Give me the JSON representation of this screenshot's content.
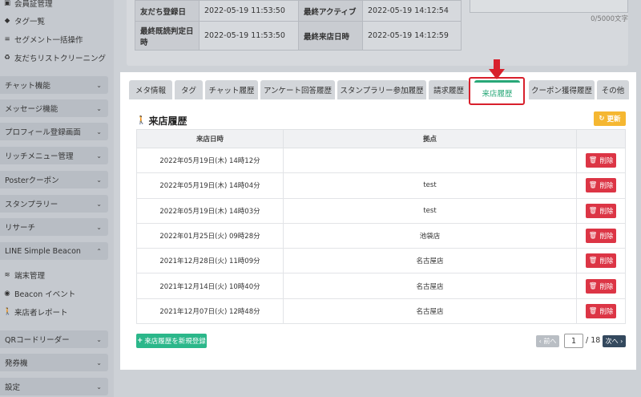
{
  "sidebar": {
    "top_items": [
      {
        "label": "会員証管理",
        "icon": "id-card-icon"
      },
      {
        "label": "タグ一覧",
        "icon": "tag-icon"
      },
      {
        "label": "セグメント一括操作",
        "icon": "database-icon"
      },
      {
        "label": "友だちリストクリーニング",
        "icon": "recycle-icon"
      }
    ],
    "sections": [
      {
        "label": "チャット機能"
      },
      {
        "label": "メッセージ機能"
      },
      {
        "label": "プロフィール登録画面"
      },
      {
        "label": "リッチメニュー管理"
      },
      {
        "label": "Posterクーポン"
      },
      {
        "label": "スタンプラリー"
      },
      {
        "label": "リサーチ"
      },
      {
        "label": "LINE Simple Beacon"
      }
    ],
    "beacon_items": [
      {
        "label": "端末管理",
        "icon": "wifi-icon"
      },
      {
        "label": "Beacon イベント",
        "icon": "broadcast-icon"
      },
      {
        "label": "来店者レポート",
        "icon": "walking-person-icon"
      }
    ],
    "bottom_sections": [
      {
        "label": "QRコードリーダー"
      },
      {
        "label": "発券機"
      },
      {
        "label": "設定"
      }
    ]
  },
  "info": {
    "rows": [
      {
        "label1": "友だち登録日",
        "value1": "2022-05-19 11:53:50",
        "label2": "最終アクティブ",
        "value2": "2022-05-19 14:12:54"
      },
      {
        "label1": "最終既読判定日時",
        "value1": "2022-05-19 11:53:50",
        "label2": "最終来店日時",
        "value2": "2022-05-19 14:12:59"
      }
    ],
    "memo_count": "0/5000文字"
  },
  "tabs": [
    {
      "label": "メタ情報"
    },
    {
      "label": "タグ"
    },
    {
      "label": "チャット履歴"
    },
    {
      "label": "アンケート回答履歴"
    },
    {
      "label": "スタンプラリー参加履歴"
    },
    {
      "label": "請求履歴"
    },
    {
      "label": "来店履歴",
      "active": true
    },
    {
      "label": "クーポン獲得履歴"
    },
    {
      "label": "その他"
    }
  ],
  "visit": {
    "title": "来店履歴",
    "refresh_label": "更新",
    "columns": [
      "来店日時",
      "拠点",
      ""
    ],
    "delete_label": "削除",
    "rows": [
      {
        "date": "2022年05月19日(木) 14時12分",
        "location": ""
      },
      {
        "date": "2022年05月19日(木) 14時04分",
        "location": "test"
      },
      {
        "date": "2022年05月19日(木) 14時03分",
        "location": "test"
      },
      {
        "date": "2022年01月25日(火) 09時28分",
        "location": "池袋店"
      },
      {
        "date": "2021年12月28日(火) 11時09分",
        "location": "名古屋店"
      },
      {
        "date": "2021年12月14日(火) 10時40分",
        "location": "名古屋店"
      },
      {
        "date": "2021年12月07日(火) 12時48分",
        "location": "名古屋店"
      }
    ],
    "add_label": "来店履歴を新規登録",
    "pagination": {
      "prev_label": "前へ",
      "current": "1",
      "total": "/ 18",
      "next_label": "次へ"
    }
  },
  "colors": {
    "accent": "#28a878",
    "danger": "#dc3545",
    "warning": "#f5b731",
    "highlight": "#d8202c"
  }
}
